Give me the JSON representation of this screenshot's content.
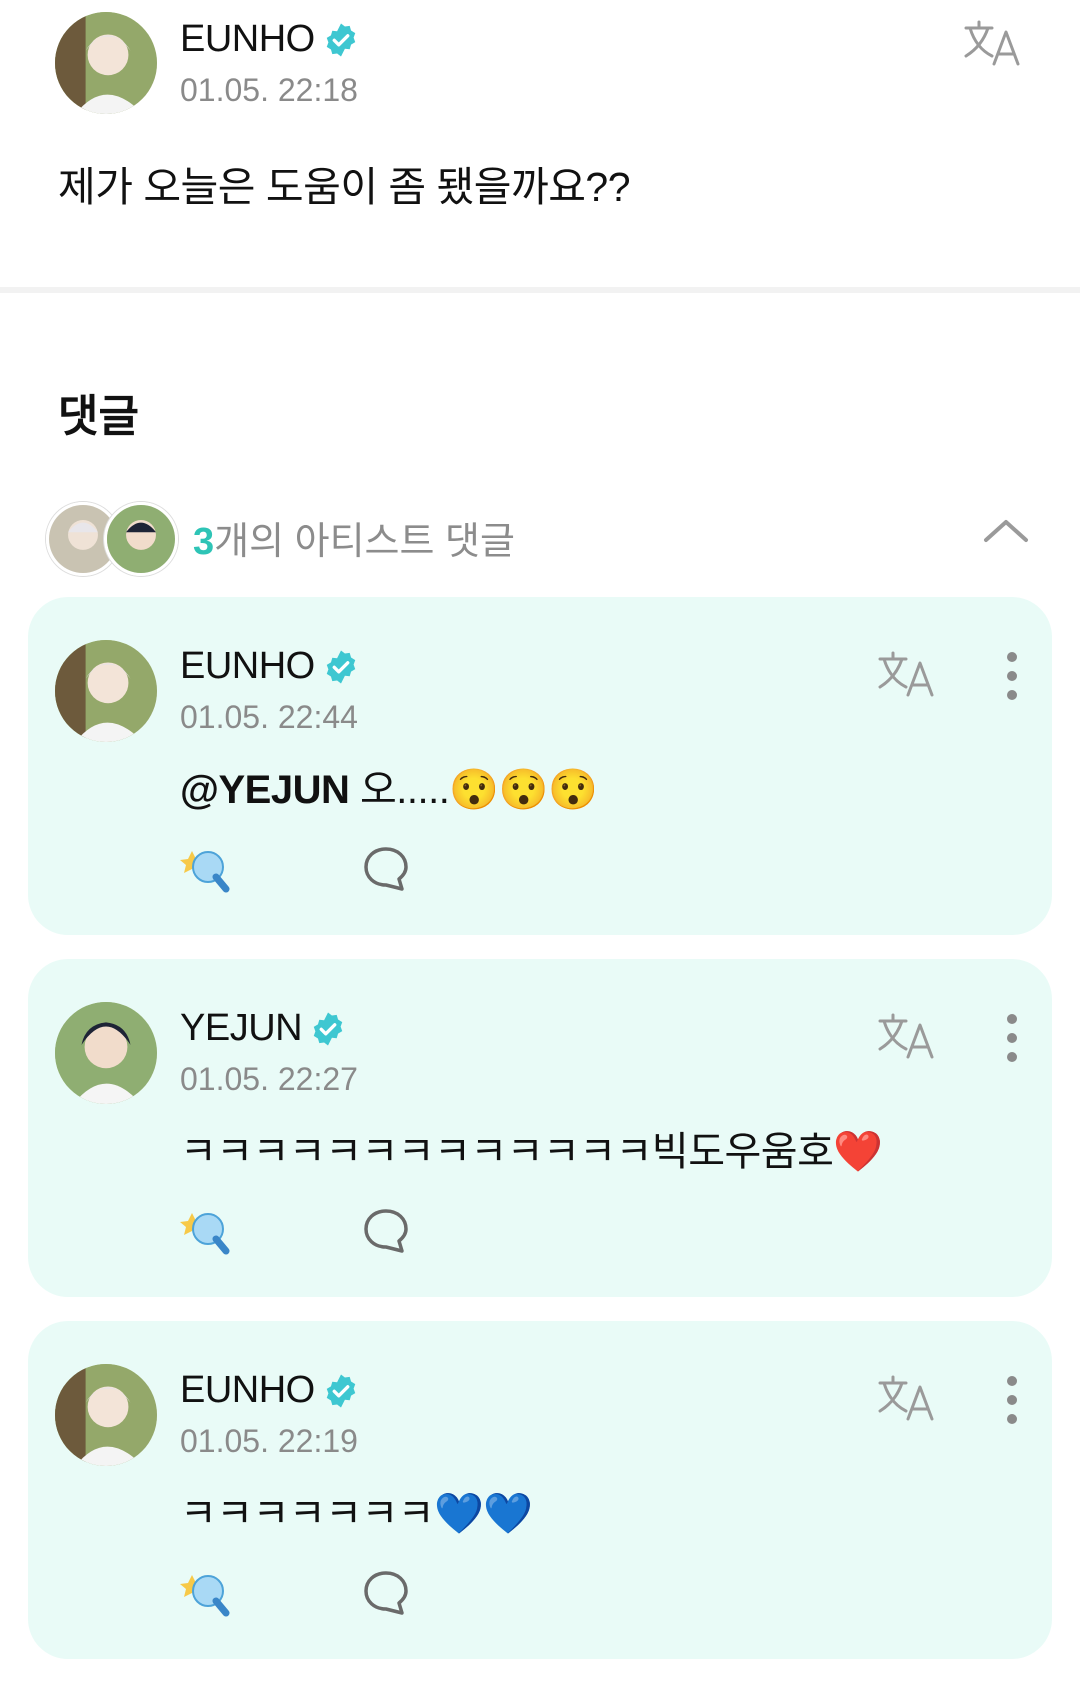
{
  "post": {
    "author": "EUNHO",
    "time": "01.05. 22:18",
    "body": "제가 오늘은 도움이 좀 됐을까요??"
  },
  "comments_section": {
    "title": "댓글",
    "artist_count": "3",
    "artist_label": "개의 아티스트 댓글"
  },
  "comments": [
    {
      "author": "EUNHO",
      "time": "01.05. 22:44",
      "mention": "@YEJUN",
      "text": " 오.....😯😯😯"
    },
    {
      "author": "YEJUN",
      "time": "01.05. 22:27",
      "mention": "",
      "text": "ㅋㅋㅋㅋㅋㅋㅋㅋㅋㅋㅋㅋㅋ빅도우움호❤️"
    },
    {
      "author": "EUNHO",
      "time": "01.05. 22:19",
      "mention": "",
      "text": "ㅋㅋㅋㅋㅋㅋㅋ💙💙"
    }
  ],
  "icons": {
    "verified": "verified-badge-icon",
    "translate": "translate-icon",
    "more": "more-vertical-icon",
    "like": "light-stick-icon",
    "reply": "speech-bubble-icon",
    "collapse": "chevron-up-icon"
  },
  "colors": {
    "accent": "#2ec4b6",
    "card_bg": "#e9fbf7",
    "verified": "#3ec7d1"
  }
}
